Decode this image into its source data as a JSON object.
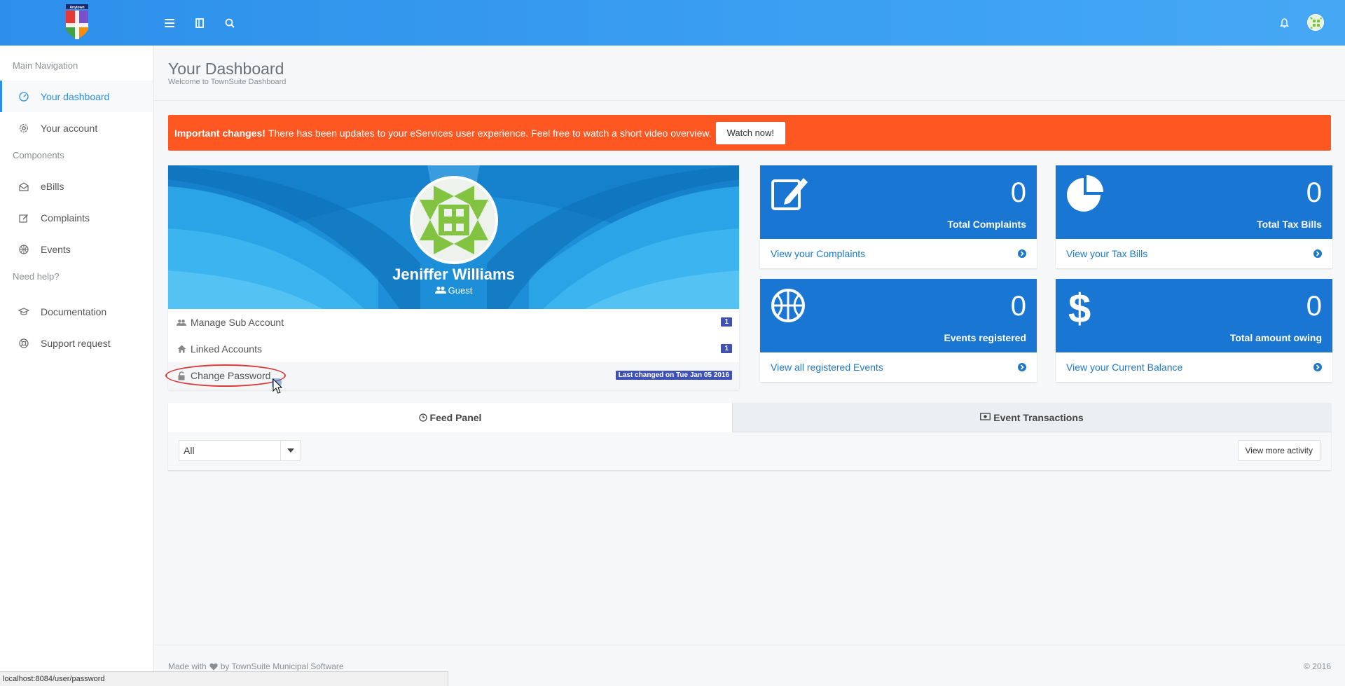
{
  "header": {
    "logo_text": "Anytown",
    "icons": [
      "menu-icon",
      "book-icon",
      "search-icon",
      "bell-icon",
      "avatar"
    ]
  },
  "sidebar": {
    "sections": [
      {
        "title": "Main Navigation"
      },
      {
        "title": "Components"
      },
      {
        "title": "Need help?"
      }
    ],
    "items": [
      {
        "label": "Your dashboard",
        "icon": "dashboard-icon",
        "active": true
      },
      {
        "label": "Your account",
        "icon": "gear-icon"
      },
      {
        "label": "eBills",
        "icon": "envelope-open-icon"
      },
      {
        "label": "Complaints",
        "icon": "edit-icon"
      },
      {
        "label": "Events",
        "icon": "basketball-icon"
      },
      {
        "label": "Documentation",
        "icon": "graduation-cap-icon"
      },
      {
        "label": "Support request",
        "icon": "lifebuoy-icon"
      }
    ]
  },
  "page": {
    "title": "Your Dashboard",
    "subtitle": "Welcome to TownSuite Dashboard"
  },
  "alert": {
    "strong": "Important changes!",
    "text": "There has been updates to your eServices user experience. Feel free to watch a short video overview.",
    "button": "Watch now!",
    "color": "#ff5722"
  },
  "profile": {
    "name": "Jeniffer Williams",
    "role": "Guest",
    "items": [
      {
        "label": "Manage Sub Account",
        "icon": "users-icon",
        "badge": "1"
      },
      {
        "label": "Linked Accounts",
        "icon": "home-icon",
        "badge": "1"
      },
      {
        "label": "Change Password",
        "icon": "unlock-icon",
        "badge": "Last changed on Tue Jan 05 2016"
      }
    ]
  },
  "stats": [
    {
      "value": "0",
      "label": "Total Complaints",
      "link": "View your Complaints",
      "icon": "edit-icon"
    },
    {
      "value": "0",
      "label": "Total Tax Bills",
      "link": "View your Tax Bills",
      "icon": "pie-chart-icon"
    },
    {
      "value": "0",
      "label": "Events registered",
      "link": "View all registered Events",
      "icon": "basketball-icon"
    },
    {
      "value": "0",
      "label": "Total amount owing",
      "link": "View your Current Balance",
      "icon": "dollar-icon"
    }
  ],
  "feed": {
    "tabs": [
      {
        "label": "Feed Panel",
        "icon": "clock-icon"
      },
      {
        "label": "Event Transactions",
        "icon": "money-icon"
      }
    ],
    "filter_value": "All",
    "more_button": "View more activity"
  },
  "footer": {
    "made_with": "Made with",
    "by": "by TownSuite Municipal Software",
    "year": "© 2016"
  },
  "statusbar": {
    "url": "localhost:8084/user/password"
  },
  "colors": {
    "topbar": "#3b9ff2",
    "card_blue": "#1976d2",
    "badge": "#3f51b5",
    "link": "#1e78c9"
  }
}
